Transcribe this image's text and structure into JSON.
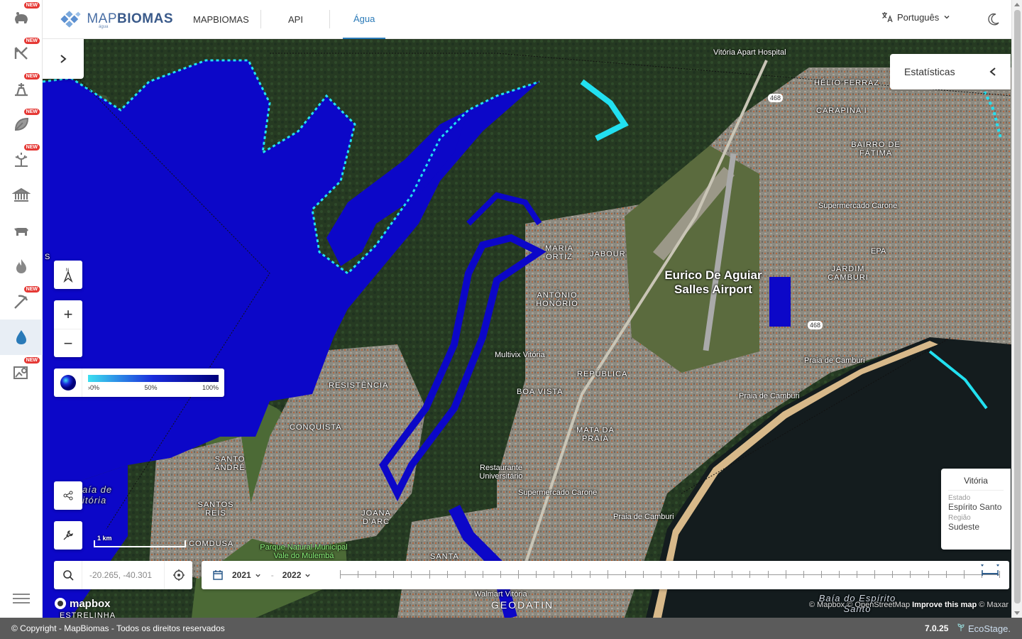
{
  "header": {
    "logo_brand_light": "MAP",
    "logo_brand_bold": "BIOMAS",
    "logo_sub": "água",
    "tabs": [
      {
        "label": "MAPBIOMAS"
      },
      {
        "label": "API"
      },
      {
        "label": "Água",
        "active": true
      }
    ],
    "language": "Português"
  },
  "sidebar": {
    "new_badge": "NEW",
    "items": [
      {
        "icon": "cattle-icon",
        "new": true
      },
      {
        "icon": "degradation-icon",
        "new": true
      },
      {
        "icon": "irrigation-icon",
        "new": true
      },
      {
        "icon": "leaf-icon",
        "new": true
      },
      {
        "icon": "sunlight-plant-icon",
        "new": true
      },
      {
        "icon": "institution-icon",
        "new": false
      },
      {
        "icon": "cow-icon",
        "new": false
      },
      {
        "icon": "fire-icon",
        "new": false
      },
      {
        "icon": "pickaxe-icon",
        "new": true
      },
      {
        "icon": "water-drop-icon",
        "new": false,
        "active": true
      },
      {
        "icon": "image-search-icon",
        "new": true
      }
    ]
  },
  "map": {
    "stats_label": "Estatísticas",
    "legend": {
      "min": "›0%",
      "mid": "50%",
      "max": "100%",
      "colors": [
        "#3de0f0",
        "#1a2bdb",
        "#00007a"
      ]
    },
    "scale": "1 km",
    "search_value": "-20.265, -40.301",
    "years": {
      "start": "2021",
      "end": "2022"
    },
    "info_card": {
      "title": "Vitória",
      "state_label": "Estado",
      "state": "Espírito Santo",
      "region_label": "Região",
      "region": "Sudeste"
    },
    "labels": {
      "airport": "Eurico De Aguiar Salles Airport",
      "vitoria_hospital": "Vitória Apart Hospital",
      "helio_ferraz": "HÉLIO FERRAZ",
      "carapina": "CARAPINA I",
      "bairro_fatima": "BAIRRO DE FÁTIMA",
      "supermercado1": "Supermercado Carone",
      "epa": "EPA",
      "jardim_camburi": "JARDIM CAMBURI",
      "maria_ortiz": "MARIA ORTIZ",
      "jabour": "JABOUR",
      "antonio_honorio": "ANTÔNIO HONÓRIO",
      "multivix": "Multivix Vitória",
      "republica": "REPÚBLICA",
      "boa_vista": "BOA VISTA",
      "praia_camburi1": "Praia de Camburi",
      "praia_camburi2": "Praia de Camburi",
      "praia_camburi3": "Praia de Camburi",
      "resistencia": "RESISTÊNCIA",
      "conquista": "CONQUISTA",
      "mata_praia": "MATA DA PRAIA",
      "santo_andre": "SANTO ANDRÉ",
      "restaurante": "Restaurante Universitário",
      "supermercado2": "Supermercado Carone",
      "baia_vitoria": "aía de itória",
      "santos_reis": "SANTOS REIS",
      "joana_darc": "JOANA D'ARC",
      "parque": "Parque Natural Municipal Vale do Mulembá",
      "comdusa": "COMDUSA",
      "santa": "SANTA",
      "walmart": "Walmart Vitória",
      "estrelinha": "ESTRELINHA",
      "baia_es": "Baía do Espírito Santo",
      "road_468a": "468",
      "road_468b": "468",
      "s_edge": "S"
    },
    "mapbox": "mapbox",
    "geodatin": "GEODATIN",
    "attribution_a": "© Mapbox © OpenStreetMap",
    "attribution_b": "Improve this map",
    "attribution_c": "© Maxar"
  },
  "footer": {
    "copyright": "© Copyright - MapBiomas - Todos os direitos reservados",
    "version": "7.0.25",
    "partner": "EcoStage."
  }
}
